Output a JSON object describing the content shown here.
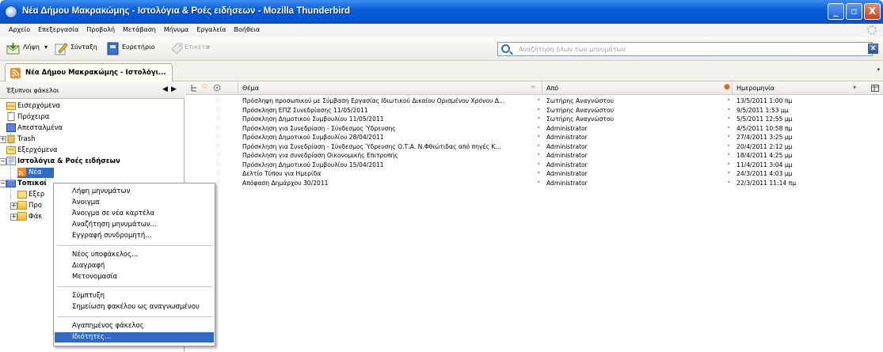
{
  "window": {
    "title": "Νέα Δήμου Μακρακώμης - Ιστολόγια & Ροές ειδήσεων - Mozilla Thunderbird",
    "minimize": "_",
    "maximize": "▫",
    "close": "X"
  },
  "menubar": [
    "Αρχείο",
    "Επεξεργασία",
    "Προβολή",
    "Μετάβαση",
    "Μήνυμα",
    "Εργαλεία",
    "Βοήθεια"
  ],
  "toolbar": {
    "get_mail": "Λήψη",
    "get_mail_dropdown": "▾",
    "compose": "Σύνταξη",
    "address_book": "Ευρετήριο",
    "tag": "Ετικέτα",
    "tag_dropdown": "▾",
    "search_placeholder": "Αναζήτηση όλων των μηνυμάτων",
    "clear_search": "x"
  },
  "tab": {
    "label": "Νέα Δήμου Μακρακώμης - Ιστολόγι...",
    "overflow_arrow": "▾"
  },
  "folder_pane": {
    "header": "Έξυπνοι φάκελοι",
    "prev_arrow": "◀",
    "next_arrow": "▶",
    "items": [
      "Εισερχόμενα",
      "Πρόχειρα",
      "Απεσταλμένα",
      "Trash",
      "Εξερχόμενα",
      "Ιστολόγια & Ροές ειδήσεων",
      "Νέα",
      "Τοπικοί",
      "Εξερ",
      "Προ",
      "Φάκ"
    ]
  },
  "message_list": {
    "columns": {
      "subject": "Θέμα",
      "from": "Από",
      "date": "Ημερομηνία"
    },
    "rows": [
      {
        "subject": "Πρόσληψη προσωπικού με Σύμβαση Εργασίας Ιδιωτικού Δικαίου Ορισμένου Χρόνου Δ...",
        "from": "Σωτήρης Αναγνώστου",
        "date": "13/5/2011 1:00 πμ"
      },
      {
        "subject": "Πρόσκληση ΕΠΖ Συνεδρίασης 11/05/2011",
        "from": "Σωτήρης Αναγνώστου",
        "date": "9/5/2011 1:53 μμ"
      },
      {
        "subject": "Πρόσκληση Δημοτικού Συμβουλίου 11/05/2011",
        "from": "Σωτήρης Αναγνώστου",
        "date": "5/5/2011 12:55 μμ"
      },
      {
        "subject": "Πρόσκληση για Συνεδρίαση - Σύνδεσμος Ύδρευσης",
        "from": "Administrator",
        "date": "4/5/2011 10:58 πμ"
      },
      {
        "subject": "Πρόσκληση Δημοτικού Συμβουλίου 28/04/2011",
        "from": "Administrator",
        "date": "27/4/2011 3:25 μμ"
      },
      {
        "subject": "Πρόσκληση για Συνεδρίαση - Σύνδεσμος Ύδρευσης Ο.Τ.Α. Ν.Φθιώτιδας από πηγές Κ...",
        "from": "Administrator",
        "date": "20/4/2011 2:12 μμ"
      },
      {
        "subject": "Πρόσκληση για συνεδρίαση Οικονομικής Επιτροπής",
        "from": "Administrator",
        "date": "18/4/2011 4:25 μμ"
      },
      {
        "subject": "Πρόσκληση Δημοτικού Συμβουλίου 15/04/2011",
        "from": "Administrator",
        "date": "11/4/2011 3:04 μμ"
      },
      {
        "subject": "Δελτίο Τύπου για Ημερίδα",
        "from": "Administrator",
        "date": "24/3/2011 4:03 μμ"
      },
      {
        "subject": "Απόφαση Δημάρχου 30/2011",
        "from": "Administrator",
        "date": "22/3/2011 11:14 πμ"
      }
    ]
  },
  "context_menu": {
    "items": [
      "Λήψη μηνυμάτων",
      "Άνοιγμα",
      "Άνοιγμα σε νέα καρτέλα",
      "Αναζήτηση μηνυμάτων...",
      "Εγγραφή συνδρομητή...",
      "Νέος υποφάκελος...",
      "Διαγραφή",
      "Μετονομασία",
      "Σύμπτυξη",
      "Σημείωση φακέλου ως αναγνωσμένου",
      "Αγαπημένος φάκελος",
      "Ιδιότητες..."
    ],
    "highlighted": "Ιδιότητες..."
  },
  "colors": {
    "title_bar": "#0555d2",
    "selection": "#316ac5",
    "window_bg": "#ecebe6"
  }
}
